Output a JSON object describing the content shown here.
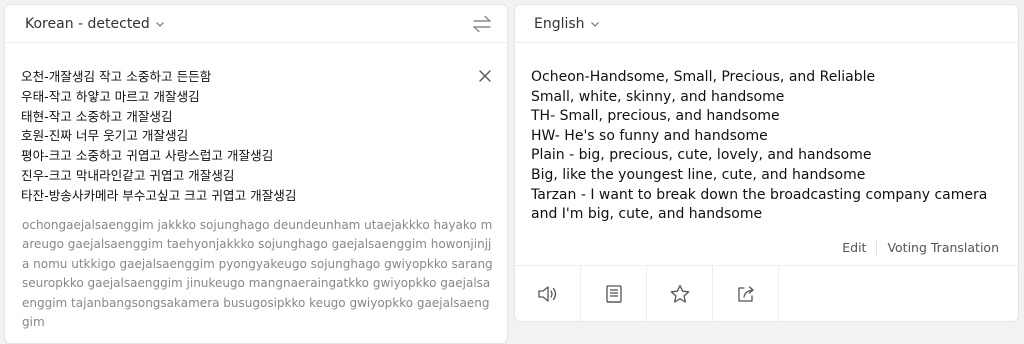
{
  "source": {
    "language_label": "Korean - detected",
    "text": "오천-개잘생김 작고 소중하고 든든함\n우태-작고 하얗고 마르고 개잘생김\n태현-작고 소중하고 개잘생김\n호원-진짜 너무 웃기고 개잘생김\n평야-크고 소중하고 귀엽고 사랑스럽고 개잘생김\n진우-크고 막내라인같고 귀엽고 개잘생김\n타잔-방송사카메라 부수고싶고 크고 귀엽고 개잘생김",
    "romanization": "ochongaejalsaenggim jakkko sojunghago deundeunham utaejakkko hayako mareugo gaejalsaenggim taehyonjakkko sojunghago gaejalsaenggim howonjinjja nomu utkkigo gaejalsaenggim pyongyakeugo sojunghago gwiyopkko sarangseuropkko gaejalsaenggim jinukeugo mangnaeraingatkko gwiyopkko gaejalsaenggim tajanbangsongsakamera busugosipkko keugo gwiyopkko gaejalsaenggim"
  },
  "target": {
    "language_label": "English",
    "text": "Ocheon-Handsome, Small, Precious, and Reliable\nSmall, white, skinny, and handsome\nTH- Small, precious, and handsome\nHW- He's so funny and handsome\nPlain - big, precious, cute, lovely, and handsome\nBig, like the youngest line, cute, and handsome\nTarzan - I want to break down the broadcasting company camera and I'm big, cute, and handsome",
    "edit_label": "Edit",
    "voting_label": "Voting Translation"
  },
  "icons": {
    "swap": "swap-arrows-icon",
    "clear": "close-icon",
    "chevron": "chevron-down-icon",
    "tools": [
      "speaker-icon",
      "book-icon",
      "star-icon",
      "share-icon"
    ]
  },
  "colors": {
    "icon": "#555555",
    "muted_text": "#888888",
    "background": "#f1f2f4"
  }
}
